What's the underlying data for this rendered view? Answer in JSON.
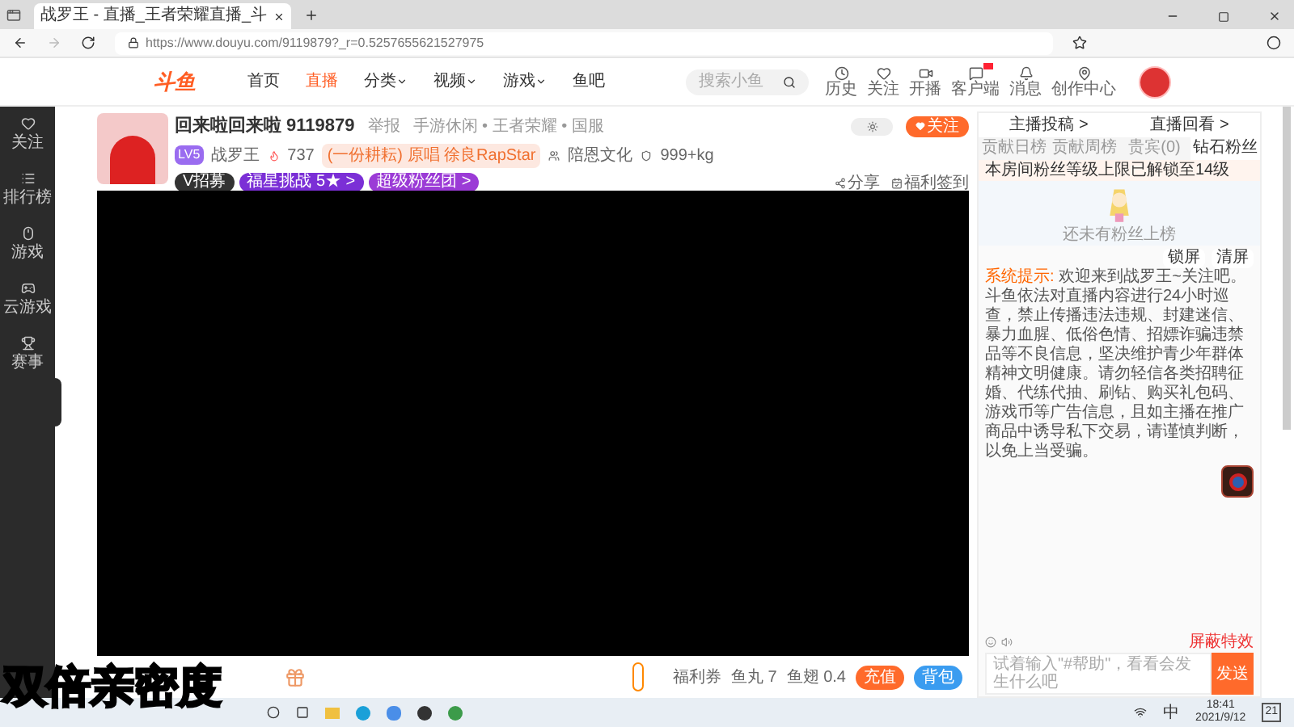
{
  "browser": {
    "tab_title": "战罗王 - 直播_王者荣耀直播_斗",
    "url": "https://www.douyu.com/9119879?_r=0.5257655621527975"
  },
  "site_nav": {
    "logo": "斗鱼",
    "items": [
      {
        "label": "首页",
        "selected": false,
        "caret": false
      },
      {
        "label": "直播",
        "selected": true,
        "caret": false
      },
      {
        "label": "分类",
        "selected": false,
        "caret": true
      },
      {
        "label": "视频",
        "selected": false,
        "caret": true
      },
      {
        "label": "游戏",
        "selected": false,
        "caret": true
      },
      {
        "label": "鱼吧",
        "selected": false,
        "caret": false
      }
    ],
    "search_placeholder": "搜索小鱼",
    "tools": [
      {
        "kind": "clock",
        "label": "历史",
        "badge": false
      },
      {
        "kind": "heart",
        "label": "关注",
        "badge": false
      },
      {
        "kind": "video",
        "label": "开播",
        "badge": false
      },
      {
        "kind": "chat",
        "label": "客户端",
        "badge": true
      },
      {
        "kind": "bell",
        "label": "消息",
        "badge": false
      },
      {
        "kind": "pin",
        "label": "创作中心",
        "badge": false
      }
    ]
  },
  "sidebar": [
    {
      "kind": "heart",
      "label": "关注"
    },
    {
      "kind": "list",
      "label": "排行榜"
    },
    {
      "kind": "mouse",
      "label": "游戏"
    },
    {
      "kind": "gamepad",
      "label": "云游戏"
    },
    {
      "kind": "trophy",
      "label": "赛事"
    }
  ],
  "room": {
    "title": "回来啦回来啦 9119879",
    "report": "举报",
    "category": "手游休闲 • 王者荣耀 • 国服",
    "streamer": "战罗王",
    "level": "LV5",
    "hot": "737",
    "song": "(一份耕耘) 原唱 徐良RapStar",
    "guild": "陪恩文化",
    "weight": "999+kg",
    "badges": [
      {
        "label": "V招募",
        "color": "#333333"
      },
      {
        "label": "福星挑战 5★ >",
        "color": "#7b2fd6"
      },
      {
        "label": "超级粉丝团 >",
        "color": "#9b3bd6"
      }
    ],
    "follow": "关注",
    "share": "分享",
    "checkin": "福利签到"
  },
  "bottom_bar": {
    "coupon": "福利券",
    "fish_ball": "鱼丸 7",
    "fish_fin": "鱼翅 0.4",
    "recharge": "充值",
    "backpack": "背包"
  },
  "overlay_caption": "双倍亲密度",
  "side_panel": {
    "links": [
      "主播投稿 >",
      "直播回看 >"
    ],
    "tabs": [
      {
        "label": "贡献日榜",
        "selected": false
      },
      {
        "label": "贡献周榜",
        "selected": false
      },
      {
        "label": "贵宾(0)",
        "selected": false
      },
      {
        "label": "钻石粉丝",
        "selected": true
      }
    ],
    "notice": "本房间粉丝等级上限已解锁至14级",
    "empty": "还未有粉丝上榜",
    "lock": "锁屏",
    "clear": "清屏",
    "system_label": "系统提示:",
    "system_text": "欢迎来到战罗王~关注吧。斗鱼依法对直播内容进行24小时巡查，禁止传播违法违规、封建迷信、暴力血腥、低俗色情、招嫖诈骗违禁品等不良信息，坚决维护青少年群体精神文明健康。请勿轻信各类招聘征婚、代练代抽、刷钻、购买礼包码、游戏币等广告信息，且如主播在推广商品中诱导私下交易，请谨慎判断，以免上当受骗。",
    "effects": "屏蔽特效",
    "input_placeholder": "试着输入\"#帮助\"，看看会发生什么吧",
    "send": "发送"
  },
  "taskbar": {
    "time": "18:41",
    "date": "2021/9/12",
    "ime": "中",
    "notifications": "21"
  }
}
